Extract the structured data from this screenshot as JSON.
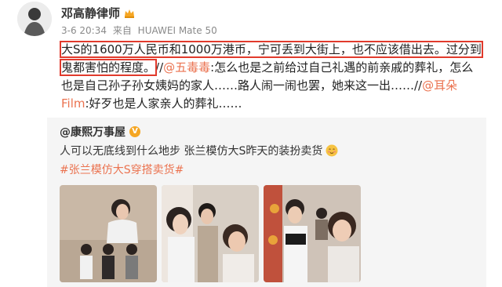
{
  "author": {
    "name": "邓高静律师",
    "badge_icon": "crown-icon"
  },
  "meta": {
    "date": "3-6 20:34",
    "source_prefix": "来自",
    "source": "HUAWEI Mate 50"
  },
  "post": {
    "line1_hl": "大S的1600万人民币和1000万港币，宁可丢到大街上，也不应该借出去。过分到",
    "line2_hl": "鬼都害怕的程度。",
    "seg1_sep": "//",
    "mention1": "@五毒毒",
    "seg1": ":怎么也是之前给过自己礼遇的前亲戚的葬礼，怎么也是自己孙子孙女姨妈的家人……路人闹一闹也罢，她来这一出……//",
    "mention2": "@耳朵Film",
    "seg2": ":好歹也是人家亲人的葬礼……"
  },
  "repost": {
    "author": "@康熙万事屋",
    "verified_icon": "verified-v-icon",
    "text": "人可以无底线到什么地步 张兰模仿大S昨天的装扮卖货",
    "emoji": "blush-emoji-icon",
    "tag": "#张兰模仿大S穿搭卖货#"
  },
  "colors": {
    "highlight_box": "#e13a2c",
    "mention": "#eb7350",
    "repost_bg": "#f5f5f5"
  }
}
